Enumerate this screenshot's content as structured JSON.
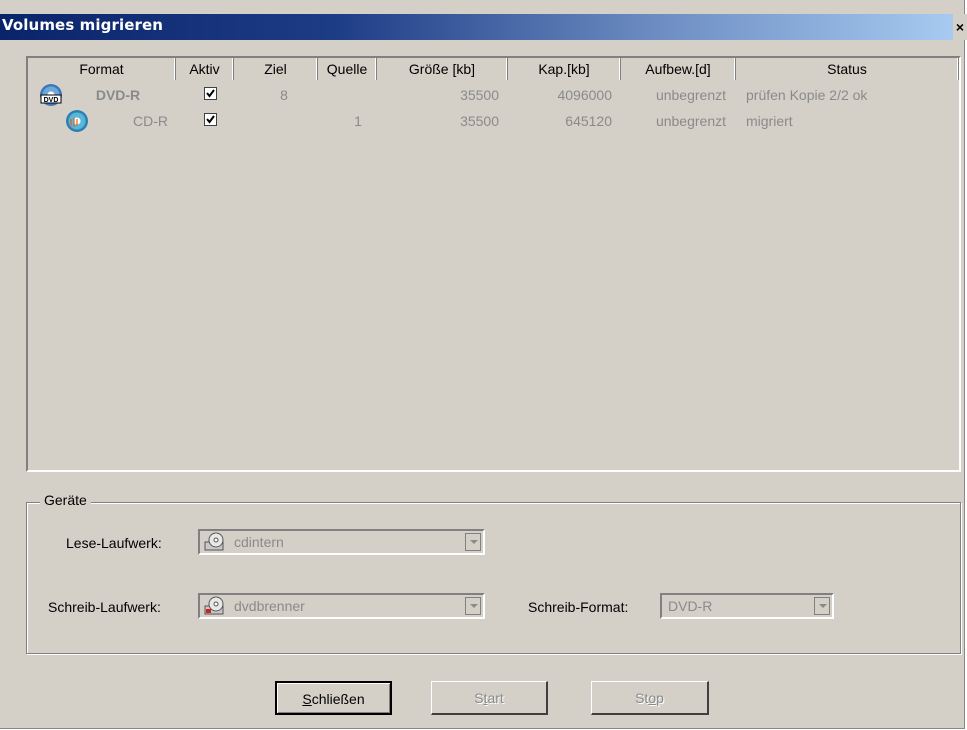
{
  "window": {
    "title": "Volumes migrieren",
    "close_glyph": "×"
  },
  "list": {
    "columns": [
      "Format",
      "Aktiv",
      "Ziel",
      "Quelle",
      "Größe [kb]",
      "Kap.[kb]",
      "Aufbew.[d]",
      "Status"
    ],
    "rows": [
      {
        "icon": "dvd-disc-icon",
        "format": "DVD-R",
        "aktiv": true,
        "ziel": "8",
        "quelle": "",
        "groesse": "35500",
        "kap": "4096000",
        "aufbew": "unbegrenzt",
        "status": "prüfen Kopie 2/2 ok"
      },
      {
        "icon": "cd-disc-icon",
        "format": "CD-R",
        "aktiv": true,
        "ziel": "",
        "quelle": "1",
        "groesse": "35500",
        "kap": "645120",
        "aufbew": "unbegrenzt",
        "status": "migriert"
      }
    ]
  },
  "devices": {
    "group_label": "Geräte",
    "read_label": "Lese-Laufwerk:",
    "read_value": "cdintern",
    "write_label": "Schreib-Laufwerk:",
    "write_value": "dvdbrenner",
    "format_label": "Schreib-Format:",
    "format_value": "DVD-R"
  },
  "buttons": {
    "close_prefix": "S",
    "close_rest": "chließen",
    "start_pre": "S",
    "start_u": "t",
    "start_post": "art",
    "stop_pre": "St",
    "stop_u": "o",
    "stop_post": "p"
  },
  "colors": {
    "title_start": "#0a246a",
    "title_end": "#a6caf0",
    "face": "#d4d0c8",
    "disabled_text": "#8a8a8a"
  }
}
